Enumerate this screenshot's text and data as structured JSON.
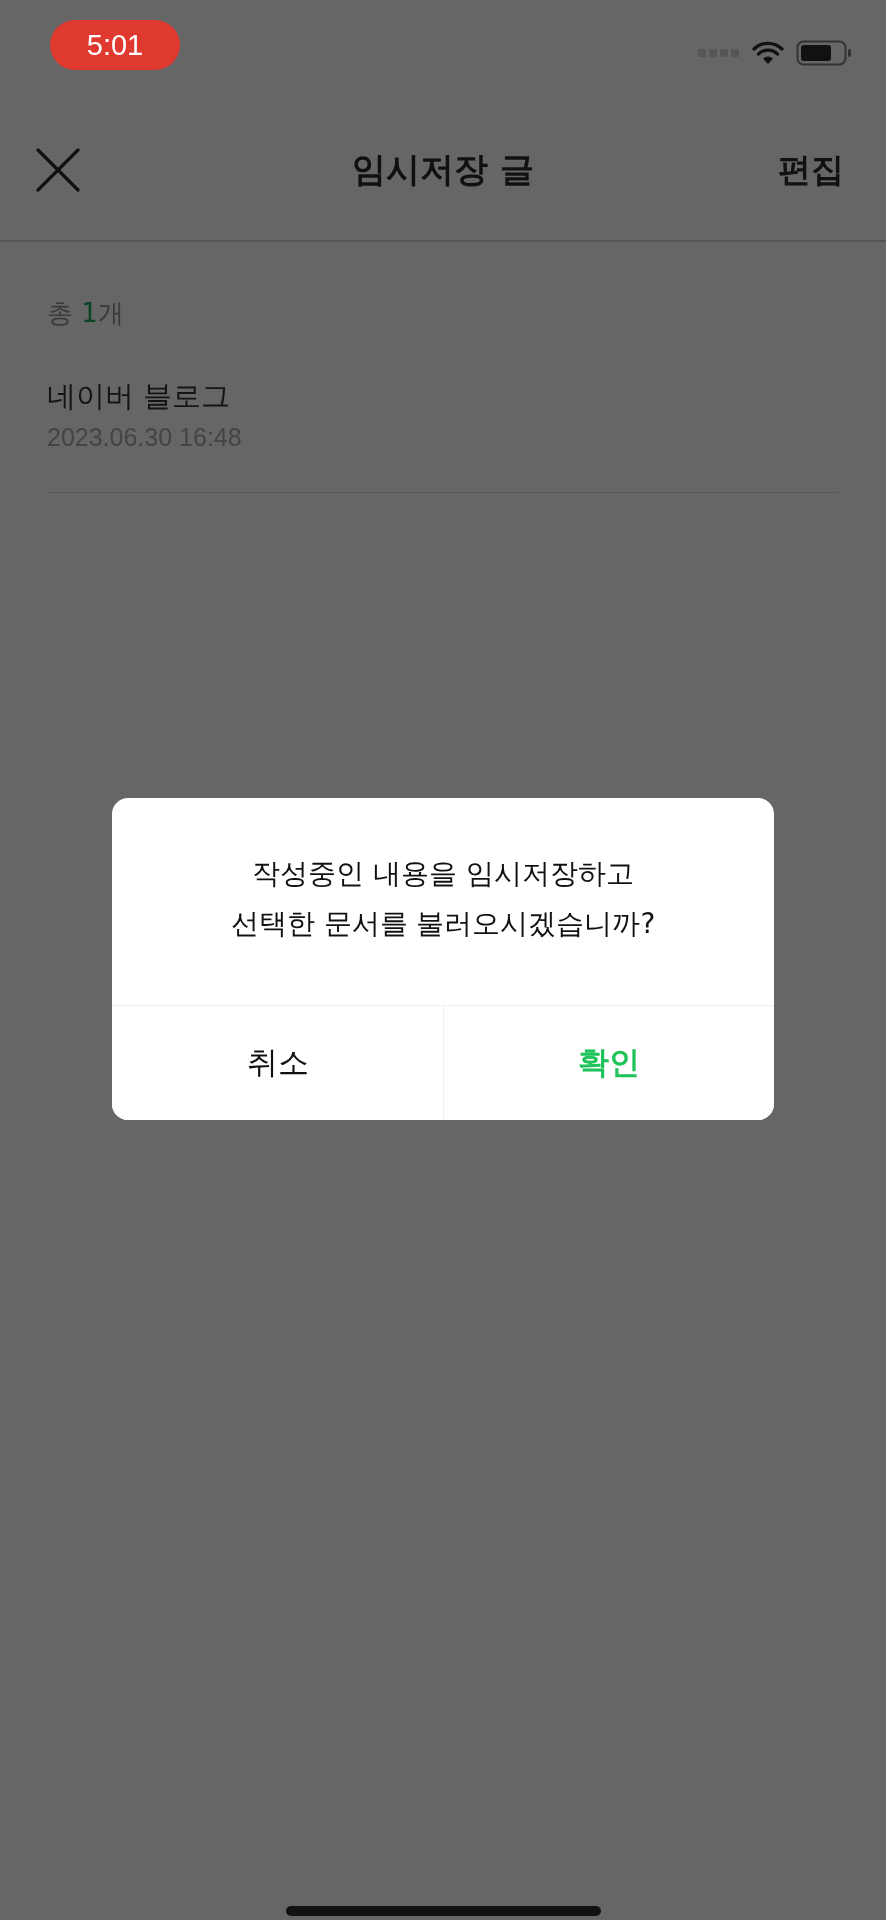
{
  "status_bar": {
    "time": "5:01"
  },
  "header": {
    "title": "임시저장 글",
    "edit_label": "편집"
  },
  "summary": {
    "prefix": "총 ",
    "count": "1",
    "suffix": "개"
  },
  "drafts": [
    {
      "title": "네이버 블로그",
      "date": "2023.06.30 16:48"
    }
  ],
  "dialog": {
    "message_lines": [
      "작성중인 내용을 임시저장하고",
      "선택한 문서를 불러오시겠습니까?"
    ],
    "buttons": [
      {
        "label": "취소",
        "kind": "cancel"
      },
      {
        "label": "확인",
        "kind": "confirm"
      }
    ]
  }
}
